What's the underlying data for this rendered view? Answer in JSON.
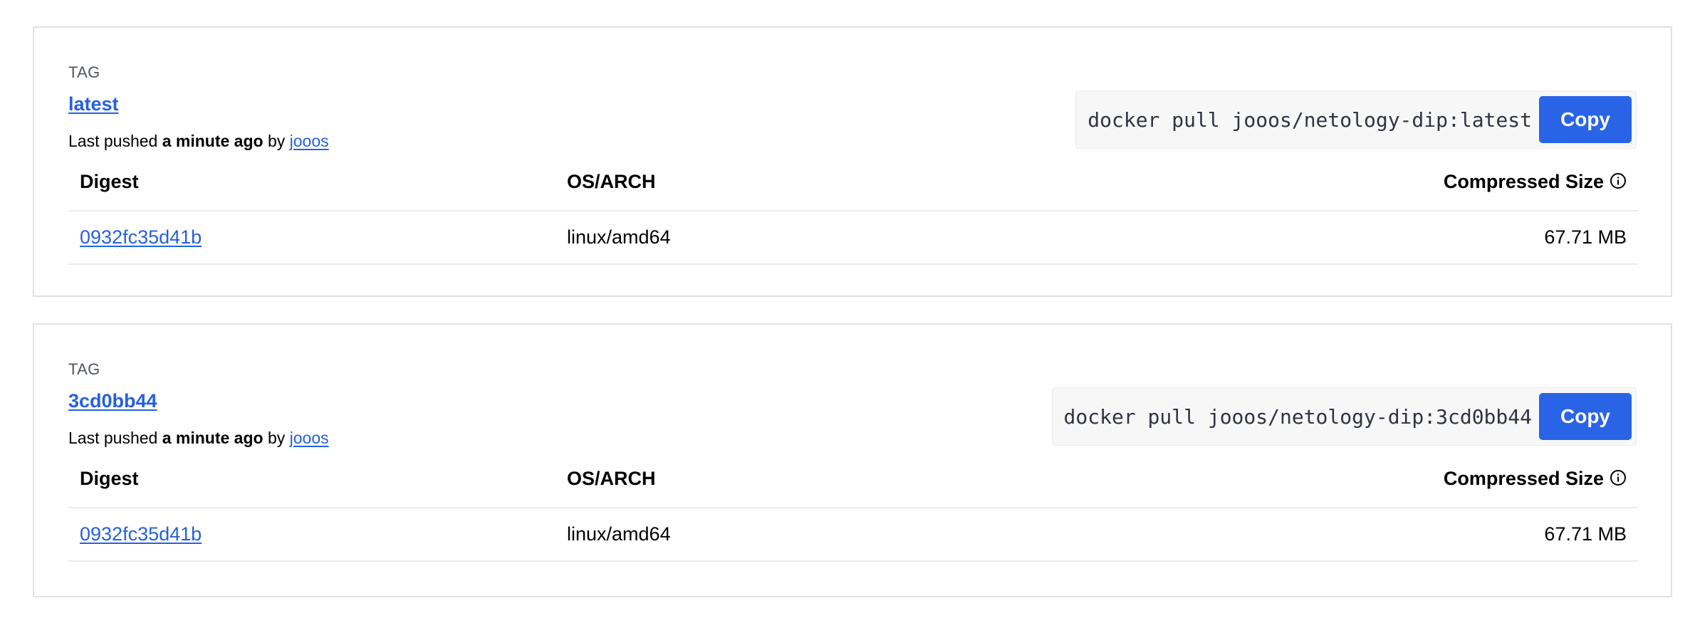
{
  "tags": [
    {
      "caption": "TAG",
      "name": "latest",
      "pushed_prefix": "Last pushed ",
      "pushed_time": "a minute ago",
      "pushed_by_word": " by ",
      "pushed_user": "jooos",
      "pull_command": "docker pull jooos/netology-dip:latest",
      "copy_label": "Copy",
      "table": {
        "headers": {
          "digest": "Digest",
          "os_arch": "OS/ARCH",
          "size": "Compressed Size"
        },
        "rows": [
          {
            "digest": "0932fc35d41b",
            "os_arch": "linux/amd64",
            "size": "67.71 MB"
          }
        ]
      }
    },
    {
      "caption": "TAG",
      "name": "3cd0bb44",
      "pushed_prefix": "Last pushed ",
      "pushed_time": "a minute ago",
      "pushed_by_word": " by ",
      "pushed_user": "jooos",
      "pull_command": "docker pull jooos/netology-dip:3cd0bb44",
      "copy_label": "Copy",
      "table": {
        "headers": {
          "digest": "Digest",
          "os_arch": "OS/ARCH",
          "size": "Compressed Size"
        },
        "rows": [
          {
            "digest": "0932fc35d41b",
            "os_arch": "linux/amd64",
            "size": "67.71 MB"
          }
        ]
      }
    }
  ],
  "colors": {
    "link": "#2560e0",
    "copy_button": "#2a64e6",
    "card_border": "#e1e2e6",
    "pull_box_bg": "#f7f7f8"
  },
  "icons": {
    "size_info": "info-circle-icon"
  }
}
